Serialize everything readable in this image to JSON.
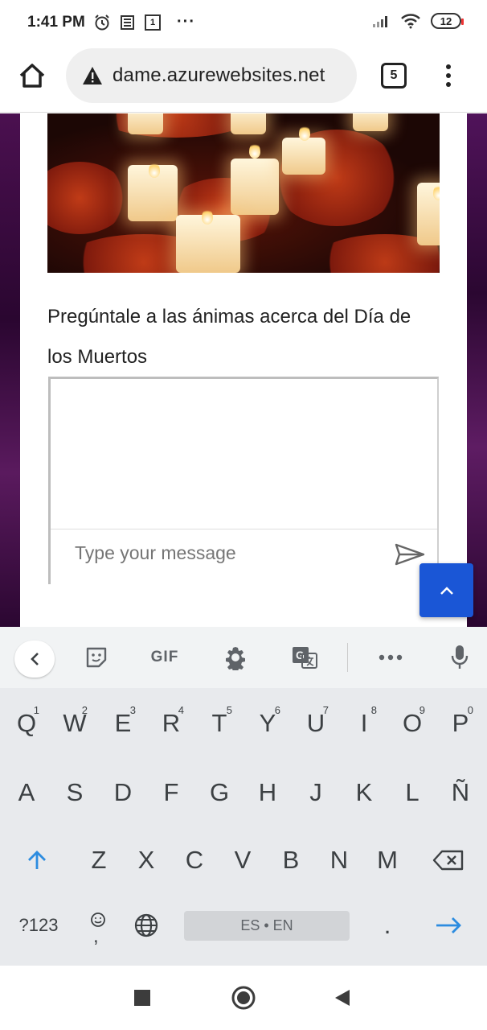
{
  "status_bar": {
    "time": "1:41 PM",
    "icons_left": [
      "alarm-icon",
      "news-icon",
      "calendar-icon",
      "more-dots-icon"
    ],
    "calendar_day": "1",
    "more": "···",
    "battery": "12",
    "icons_right": [
      "signal-icon",
      "wifi-icon",
      "battery-icon"
    ]
  },
  "browser": {
    "url": "dame.azurewebsites.net",
    "tab_count": "5",
    "security_icon": "warning-triangle-icon"
  },
  "content": {
    "prompt": "Pregúntale a las ánimas acerca del Día de los Muertos",
    "chat_placeholder": "Type your message",
    "colors": {
      "background": "#3a0c3e",
      "accent": "#1a56d6"
    }
  },
  "keyboard": {
    "toolbar": {
      "gif": "GIF"
    },
    "row1": [
      {
        "k": "Q",
        "h": "1"
      },
      {
        "k": "W",
        "h": "2"
      },
      {
        "k": "E",
        "h": "3"
      },
      {
        "k": "R",
        "h": "4"
      },
      {
        "k": "T",
        "h": "5"
      },
      {
        "k": "Y",
        "h": "6"
      },
      {
        "k": "U",
        "h": "7"
      },
      {
        "k": "I",
        "h": "8"
      },
      {
        "k": "O",
        "h": "9"
      },
      {
        "k": "P",
        "h": "0"
      }
    ],
    "row2": [
      "A",
      "S",
      "D",
      "F",
      "G",
      "H",
      "J",
      "K",
      "L",
      "Ñ"
    ],
    "row3": [
      "Z",
      "X",
      "C",
      "V",
      "B",
      "N",
      "M"
    ],
    "symbols": "?123",
    "comma": ",",
    "space": "ES • EN",
    "period": "."
  }
}
